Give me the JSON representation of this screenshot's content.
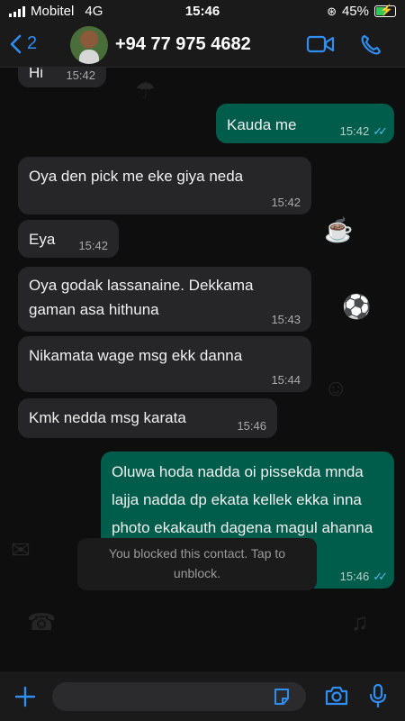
{
  "status_bar": {
    "carrier": "Mobitel",
    "network": "4G",
    "time": "15:46",
    "battery": "45%",
    "battery_level": 0.45
  },
  "header": {
    "back_count": "2",
    "contact_name": "+94 77 975 4682"
  },
  "messages": [
    {
      "direction": "in",
      "text": "Hi",
      "time": "15:42"
    },
    {
      "direction": "out",
      "text": "Kauda me",
      "time": "15:42",
      "read": true
    },
    {
      "direction": "in",
      "text": "Oya den pick me eke giya neda",
      "time": "15:42"
    },
    {
      "direction": "in",
      "text": "Eya",
      "time": "15:42"
    },
    {
      "direction": "in",
      "text": "Oya godak lassanaine. Dekkama gaman asa hithuna",
      "time": "15:43"
    },
    {
      "direction": "in",
      "text": "Nikamata wage msg ekk danna",
      "time": "15:44"
    },
    {
      "direction": "in",
      "text": "Kmk nedda msg karata",
      "time": "15:46"
    },
    {
      "direction": "out",
      "text": "Oluwa hoda nadda oi pissekda mnda lajja nadda dp ekata kellek ekka inna photo ekakauth dagena magul ahanna enawa",
      "time": "15:46",
      "read": true
    }
  ],
  "blocked_notice": "You blocked this contact. Tap to unblock.",
  "composer": {
    "placeholder": ""
  },
  "colors": {
    "accent": "#2f8ef2",
    "outgoing_bubble": "#005c4b",
    "incoming_bubble": "#262628",
    "read_ticks": "#53bdeb"
  }
}
